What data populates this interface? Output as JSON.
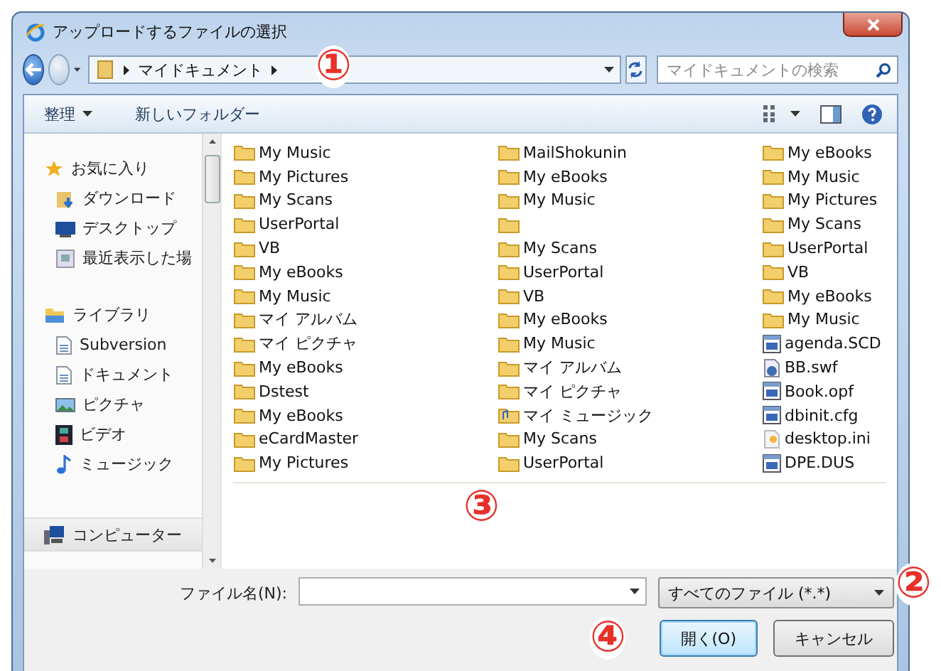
{
  "window": {
    "title": "アップロードするファイルの選択"
  },
  "address": {
    "crumbs": [
      "マイドキュメント"
    ],
    "search_placeholder": "マイドキュメントの検索"
  },
  "toolbar": {
    "organize": "整理",
    "new_folder": "新しいフォルダー"
  },
  "sidebar": {
    "sections": [
      {
        "label": "お気に入り",
        "kind": "star",
        "items": [
          {
            "label": "ダウンロード",
            "kind": "download"
          },
          {
            "label": "デスクトップ",
            "kind": "desktop"
          },
          {
            "label": "最近表示した場",
            "kind": "recent"
          }
        ]
      },
      {
        "label": "ライブラリ",
        "kind": "library",
        "items": [
          {
            "label": "Subversion",
            "kind": "doc"
          },
          {
            "label": "ドキュメント",
            "kind": "doc"
          },
          {
            "label": "ピクチャ",
            "kind": "picture"
          },
          {
            "label": "ビデオ",
            "kind": "video"
          },
          {
            "label": "ミュージック",
            "kind": "music"
          }
        ]
      }
    ],
    "computer": "コンピューター"
  },
  "files": {
    "columns": [
      [
        {
          "name": "My Music",
          "kind": "folder"
        },
        {
          "name": "My Pictures",
          "kind": "folder"
        },
        {
          "name": "My Scans",
          "kind": "folder"
        },
        {
          "name": "UserPortal",
          "kind": "folder"
        },
        {
          "name": "VB",
          "kind": "folder"
        },
        {
          "name": "My eBooks",
          "kind": "folder"
        },
        {
          "name": "My Music",
          "kind": "folder"
        },
        {
          "name": "マイ アルバム",
          "kind": "folder"
        },
        {
          "name": "マイ ピクチャ",
          "kind": "folder"
        },
        {
          "name": "My eBooks",
          "kind": "folder"
        },
        {
          "name": "Dstest",
          "kind": "folder"
        },
        {
          "name": "My eBooks",
          "kind": "folder"
        },
        {
          "name": "eCardMaster",
          "kind": "folder"
        },
        {
          "name": "My Pictures",
          "kind": "folder"
        }
      ],
      [
        {
          "name": "MailShokunin",
          "kind": "folder"
        },
        {
          "name": "My eBooks",
          "kind": "folder"
        },
        {
          "name": "My Music",
          "kind": "folder"
        },
        {
          "kind": "folder"
        },
        {
          "name": "My Scans",
          "kind": "folder"
        },
        {
          "name": "UserPortal",
          "kind": "folder"
        },
        {
          "name": "VB",
          "kind": "folder"
        },
        {
          "name": "My eBooks",
          "kind": "folder"
        },
        {
          "name": "My Music",
          "kind": "folder"
        },
        {
          "name": "マイ アルバム",
          "kind": "folder"
        },
        {
          "name": "マイ ピクチャ",
          "kind": "folder"
        },
        {
          "name": "マイ ミュージック",
          "kind": "music-folder"
        },
        {
          "name": "My Scans",
          "kind": "folder"
        },
        {
          "name": "UserPortal",
          "kind": "folder"
        }
      ],
      [
        {
          "name": "My eBooks",
          "kind": "folder"
        },
        {
          "name": "My Music",
          "kind": "folder"
        },
        {
          "name": "My Pictures",
          "kind": "folder"
        },
        {
          "name": "My Scans",
          "kind": "folder"
        },
        {
          "name": "UserPortal",
          "kind": "folder"
        },
        {
          "name": "VB",
          "kind": "folder"
        },
        {
          "name": "My eBooks",
          "kind": "folder"
        },
        {
          "name": "My Music",
          "kind": "folder"
        },
        {
          "name": "agenda.SCD",
          "kind": "file"
        },
        {
          "name": "BB.swf",
          "kind": "flash"
        },
        {
          "name": "Book.opf",
          "kind": "file"
        },
        {
          "name": "dbinit.cfg",
          "kind": "file"
        },
        {
          "name": "desktop.ini",
          "kind": "settings"
        },
        {
          "name": "DPE.DUS",
          "kind": "file"
        }
      ]
    ]
  },
  "bottom": {
    "filename_label": "ファイル名(N):",
    "filter": "すべてのファイル (*.*)",
    "buttons": [
      {
        "label": "開く(O)",
        "default": true
      },
      {
        "label": "キャンセル",
        "default": false
      }
    ]
  },
  "callouts": [
    "①",
    "②",
    "③",
    "④"
  ]
}
